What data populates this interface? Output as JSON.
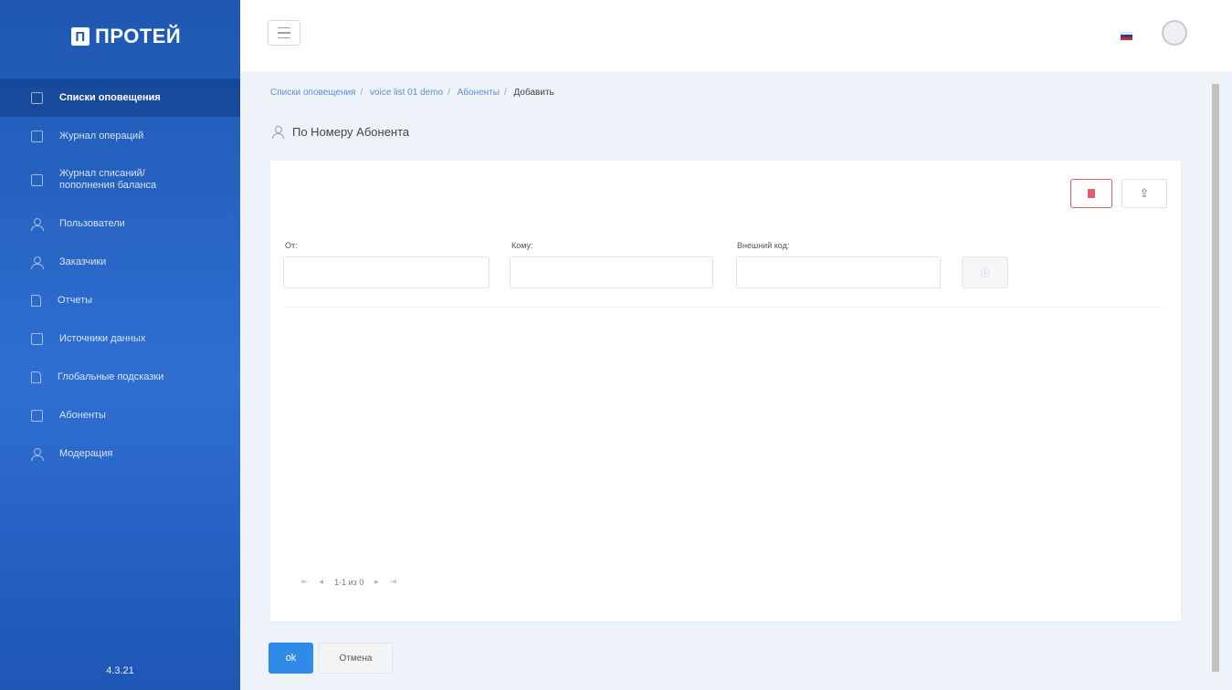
{
  "app": {
    "logo_mark": "П",
    "logo_text": "ПРОТЕЙ",
    "version": "4.3.21"
  },
  "sidebar": {
    "items": [
      {
        "label": "Списки оповещения",
        "icon": "list-icon",
        "active": true
      },
      {
        "label": "Журнал операций",
        "icon": "journal-icon"
      },
      {
        "label": "Журнал списаний/ пополнения баланса",
        "icon": "balance-icon"
      },
      {
        "label": "Пользователи",
        "icon": "users-icon"
      },
      {
        "label": "Заказчики",
        "icon": "customer-icon"
      },
      {
        "label": "Отчеты",
        "icon": "report-icon"
      },
      {
        "label": "Источники данных",
        "icon": "datasource-icon"
      },
      {
        "label": "Глобальные подсказки",
        "icon": "hints-icon"
      },
      {
        "label": "Абоненты",
        "icon": "subscribers-icon"
      },
      {
        "label": "Модерация",
        "icon": "moderation-icon"
      }
    ]
  },
  "header": {
    "flag": "ru",
    "colors": {
      "white": "#ffffff",
      "blue": "#1c3fae",
      "red": "#d52b1e"
    }
  },
  "breadcrumb": {
    "items": [
      "Списки оповещения",
      "voice list 01 demo",
      "Абоненты"
    ],
    "current": "Добавить"
  },
  "page": {
    "title": "По Номеру Абонента"
  },
  "filters": {
    "from_label": "От:",
    "from_value": "",
    "to_label": "Кому:",
    "to_value": "",
    "ext_code_label": "Внешний код:",
    "ext_code_value": ""
  },
  "pagination": {
    "first": "⇤",
    "prev": "◂",
    "text": "1-1 из 0",
    "next": "▸",
    "last": "⇥"
  },
  "actions": {
    "ok": "ok",
    "cancel": "Отмена"
  },
  "colors": {
    "sidebar": "#2563c4",
    "primary": "#2f8ae8",
    "danger": "#e35d6a"
  }
}
